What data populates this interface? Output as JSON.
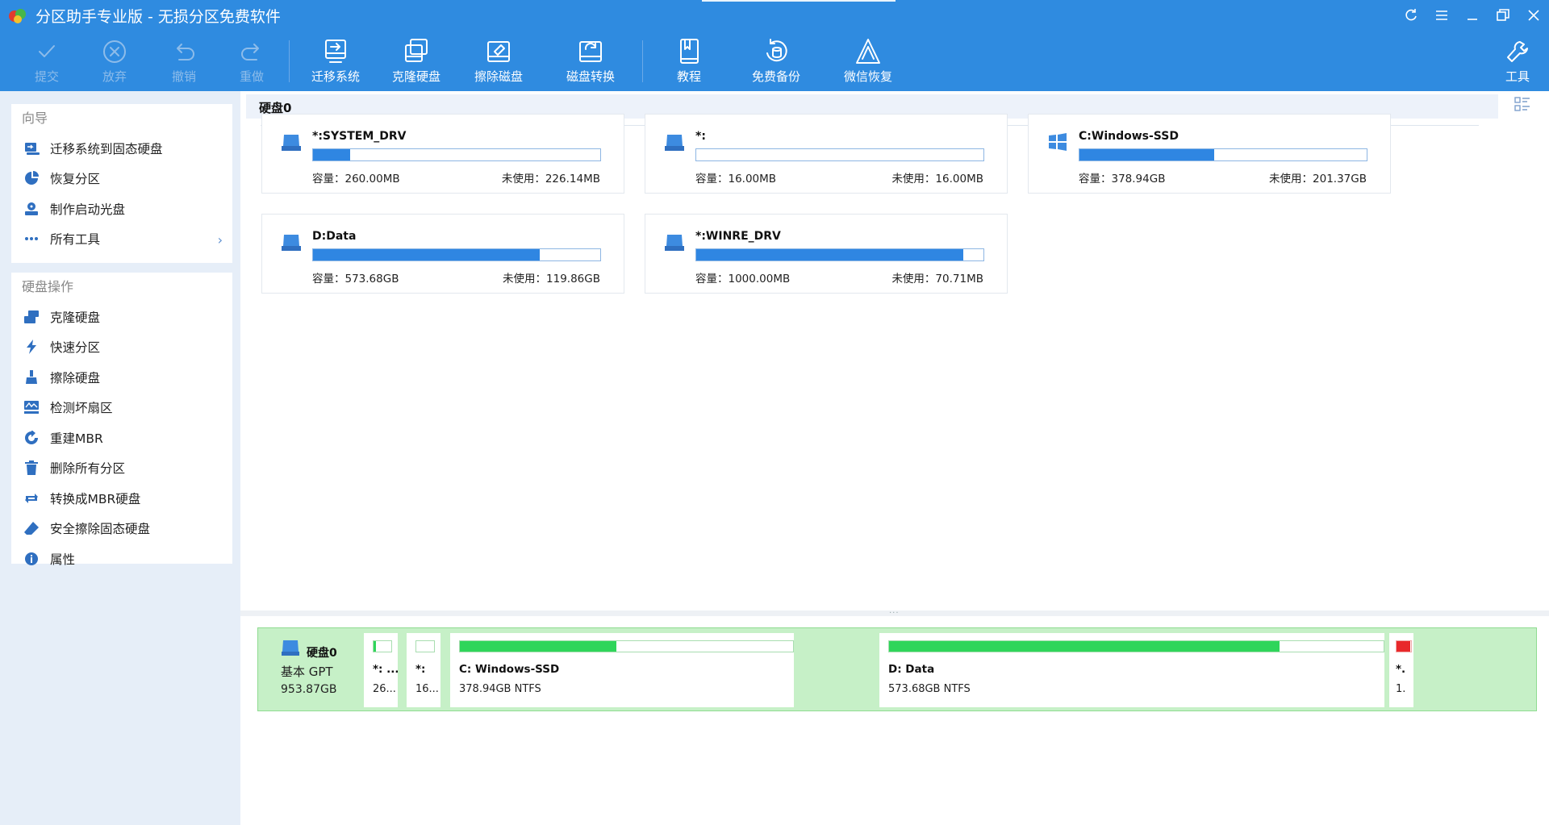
{
  "window": {
    "title": "分区助手专业版 - 无损分区免费软件",
    "controls": [
      "refresh-icon",
      "menu-icon",
      "minimize-icon",
      "restore-icon",
      "close-icon"
    ]
  },
  "toolbar": {
    "commit": "提交",
    "discard": "放弃",
    "undo": "撤销",
    "redo": "重做",
    "migrate_os": "迁移系统",
    "clone_disk": "克隆硬盘",
    "wipe_disk": "擦除磁盘",
    "disk_convert": "磁盘转换",
    "tutorial": "教程",
    "free_backup": "免费备份",
    "wechat_recovery": "微信恢复",
    "tools": "工具"
  },
  "sidebar": {
    "wizard_title": "向导",
    "wizard_items": [
      {
        "label": "迁移系统到固态硬盘",
        "icon": "migrate-ssd-icon"
      },
      {
        "label": "恢复分区",
        "icon": "recover-partition-icon"
      },
      {
        "label": "制作启动光盘",
        "icon": "bootable-media-icon"
      },
      {
        "label": "所有工具",
        "icon": "more-dots-icon"
      }
    ],
    "disk_ops_title": "硬盘操作",
    "disk_ops_items": [
      {
        "label": "克隆硬盘",
        "icon": "clone-disk-icon"
      },
      {
        "label": "快速分区",
        "icon": "quick-partition-icon"
      },
      {
        "label": "擦除硬盘",
        "icon": "wipe-disk-icon"
      },
      {
        "label": "检测坏扇区",
        "icon": "bad-sector-icon"
      },
      {
        "label": "重建MBR",
        "icon": "rebuild-mbr-icon"
      },
      {
        "label": "删除所有分区",
        "icon": "trash-icon"
      },
      {
        "label": "转换成MBR硬盘",
        "icon": "convert-icon"
      },
      {
        "label": "安全擦除固态硬盘",
        "icon": "eraser-icon"
      },
      {
        "label": "属性",
        "icon": "info-icon"
      }
    ]
  },
  "disk": {
    "title": "硬盘0",
    "cards": [
      {
        "name": "*:SYSTEM_DRV",
        "capacity": "容量：260.00MB",
        "free": "未使用：226.14MB",
        "used_fraction": 0.13,
        "icon": "drive-icon"
      },
      {
        "name": "*:",
        "capacity": "容量：16.00MB",
        "free": "未使用：16.00MB",
        "used_fraction": 0.0,
        "icon": "drive-icon"
      },
      {
        "name": "C:Windows-SSD",
        "capacity": "容量：378.94GB",
        "free": "未使用：201.37GB",
        "used_fraction": 0.47,
        "icon": "windows-icon"
      },
      {
        "name": "D:Data",
        "capacity": "容量：573.68GB",
        "free": "未使用：119.86GB",
        "used_fraction": 0.79,
        "icon": "drive-icon"
      },
      {
        "name": "*:WINRE_DRV",
        "capacity": "容量：1000.00MB",
        "free": "未使用：70.71MB",
        "used_fraction": 0.93,
        "icon": "drive-icon"
      }
    ]
  },
  "disk_map": {
    "name": "硬盘0",
    "type": "基本 GPT",
    "size": "953.87GB",
    "partitions": [
      {
        "name": "*: ...",
        "info": "26...",
        "used_fraction": 0.13,
        "color": "green"
      },
      {
        "name": "*:",
        "info": "16...",
        "used_fraction": 0.0,
        "color": "green"
      },
      {
        "name": "C: Windows-SSD",
        "info": "378.94GB NTFS",
        "used_fraction": 0.47,
        "color": "green"
      },
      {
        "name": "D: Data",
        "info": "573.68GB NTFS",
        "used_fraction": 0.79,
        "color": "green"
      },
      {
        "name": "*.",
        "info": "1.",
        "used_fraction": 0.93,
        "color": "red"
      }
    ]
  },
  "colors": {
    "titlebar": "#2f8be0",
    "usage_bar": "#2f86e2",
    "map_fill": "#2fd55a",
    "map_background": "#c6f0c7"
  }
}
